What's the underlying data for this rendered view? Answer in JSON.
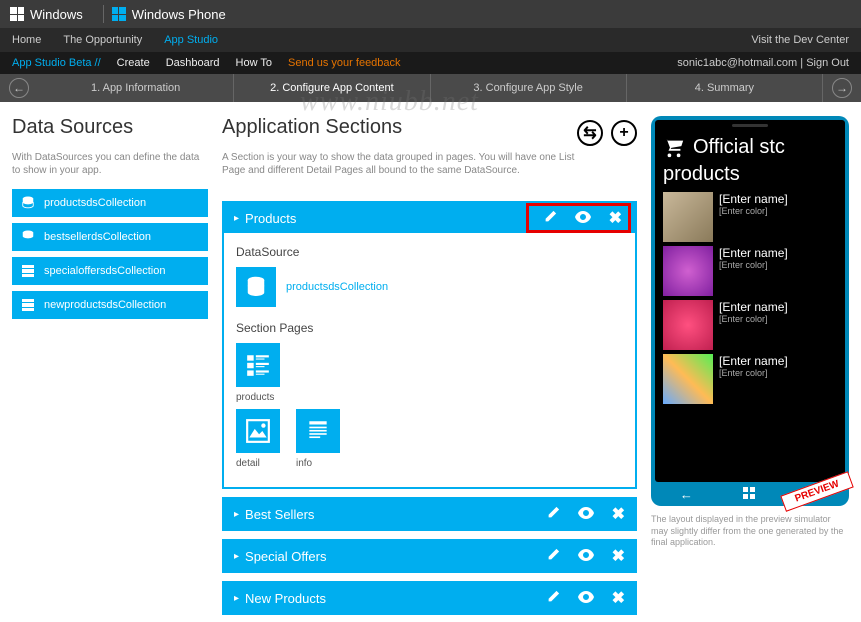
{
  "watermark": "www.niubb.net",
  "header1": {
    "windows": "Windows",
    "wp": "Windows Phone"
  },
  "header2": {
    "nav": {
      "home": "Home",
      "opportunity": "The Opportunity",
      "appstudio": "App Studio"
    },
    "right": "Visit the Dev Center"
  },
  "header3": {
    "brand": "App Studio Beta //",
    "create": "Create",
    "dashboard": "Dashboard",
    "howto": "How To",
    "feedback": "Send us your feedback",
    "email": "sonic1abc@hotmail.com",
    "signout": "Sign Out"
  },
  "header4": {
    "steps": {
      "s1": "1. App Information",
      "s2": "2. Configure App Content",
      "s3": "3. Configure App Style",
      "s4": "4. Summary"
    }
  },
  "left": {
    "title": "Data Sources",
    "desc": "With DataSources you can define the data to show in your app.",
    "items": {
      "i0": "productsdsCollection",
      "i1": "bestsellerdsCollection",
      "i2": "specialoffersdsCollection",
      "i3": "newproductsdsCollection"
    }
  },
  "mid": {
    "title": "Application Sections",
    "desc": "A Section is your way to show the data grouped in pages. You will have one List Page and different Detail Pages all bound to the same DataSource.",
    "products": {
      "header": "Products",
      "ds_label": "DataSource",
      "ds_name": "productsdsCollection",
      "sp_label": "Section Pages",
      "pages": {
        "p0": "products",
        "p1": "detail",
        "p2": "info"
      }
    },
    "bestsellers": "Best Sellers",
    "specialoffers": "Special Offers",
    "newproducts": "New Products"
  },
  "preview": {
    "title": "Official stc",
    "subtitle": "products",
    "items": {
      "name": "[Enter name]",
      "color": "[Enter color]"
    },
    "badge": "PREVIEW",
    "note": "The layout displayed in the preview simulator may slightly differ from the one generated by the final application."
  }
}
